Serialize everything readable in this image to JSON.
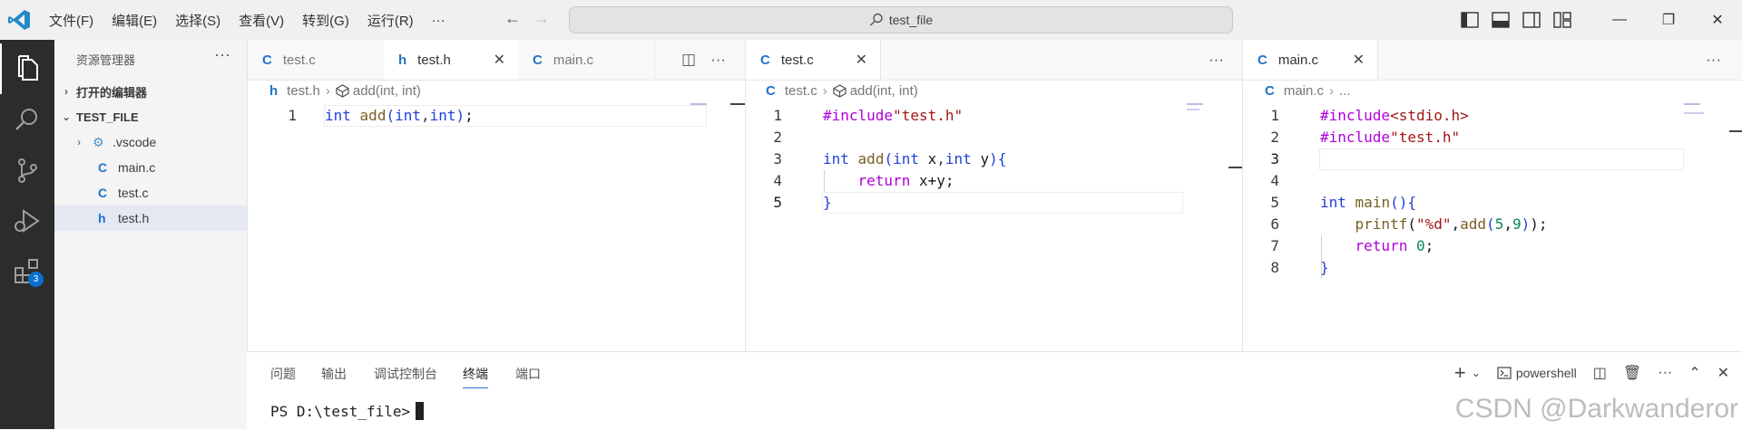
{
  "window": {
    "menu": [
      "文件(F)",
      "编辑(E)",
      "选择(S)",
      "查看(V)",
      "转到(G)",
      "运行(R)",
      "···"
    ],
    "search_text": "test_file"
  },
  "activity_bar": {
    "extensions_badge": "3"
  },
  "explorer": {
    "title": "资源管理器",
    "more": "···",
    "open_editors": "打开的编辑器",
    "folder": "TEST_FILE",
    "items": [
      {
        "icon": "⚙",
        "label": ".vscode",
        "type": "folder"
      },
      {
        "icon": "C",
        "label": "main.c",
        "type": "file"
      },
      {
        "icon": "C",
        "label": "test.c",
        "type": "file"
      },
      {
        "icon": "h",
        "label": "test.h",
        "type": "file"
      }
    ]
  },
  "group1": {
    "tabs": [
      {
        "icon": "C",
        "label": "test.c"
      },
      {
        "icon": "h",
        "label": "test.h",
        "close": "✕"
      },
      {
        "icon": "C",
        "label": "main.c"
      }
    ],
    "breadcrumb": {
      "file_icon": "h",
      "file": "test.h",
      "symbol": "add(int, int)"
    },
    "line_numbers": [
      "1"
    ]
  },
  "group2": {
    "tabs": [
      {
        "icon": "C",
        "label": "test.c",
        "close": "✕"
      }
    ],
    "breadcrumb": {
      "file_icon": "C",
      "file": "test.c",
      "symbol": "add(int, int)"
    },
    "line_numbers": [
      "1",
      "2",
      "3",
      "4",
      "5"
    ]
  },
  "group3": {
    "tabs": [
      {
        "icon": "C",
        "label": "main.c",
        "close": "✕"
      }
    ],
    "breadcrumb": {
      "file_icon": "C",
      "file": "main.c",
      "symbol": "..."
    },
    "line_numbers": [
      "1",
      "2",
      "3",
      "4",
      "5",
      "6",
      "7",
      "8"
    ]
  },
  "panel": {
    "tabs": [
      "问题",
      "输出",
      "调试控制台",
      "终端",
      "端口"
    ],
    "shell": "powershell",
    "terminal_prompt": "PS D:\\test_file>"
  },
  "watermark": "CSDN @Darkwanderor",
  "colors": {
    "accent": "#2472c8",
    "keyword": "#1f3fd8",
    "preprocessor": "#af00db",
    "string": "#a31515",
    "number": "#098658",
    "activity_bar": "#2c2c2c"
  }
}
